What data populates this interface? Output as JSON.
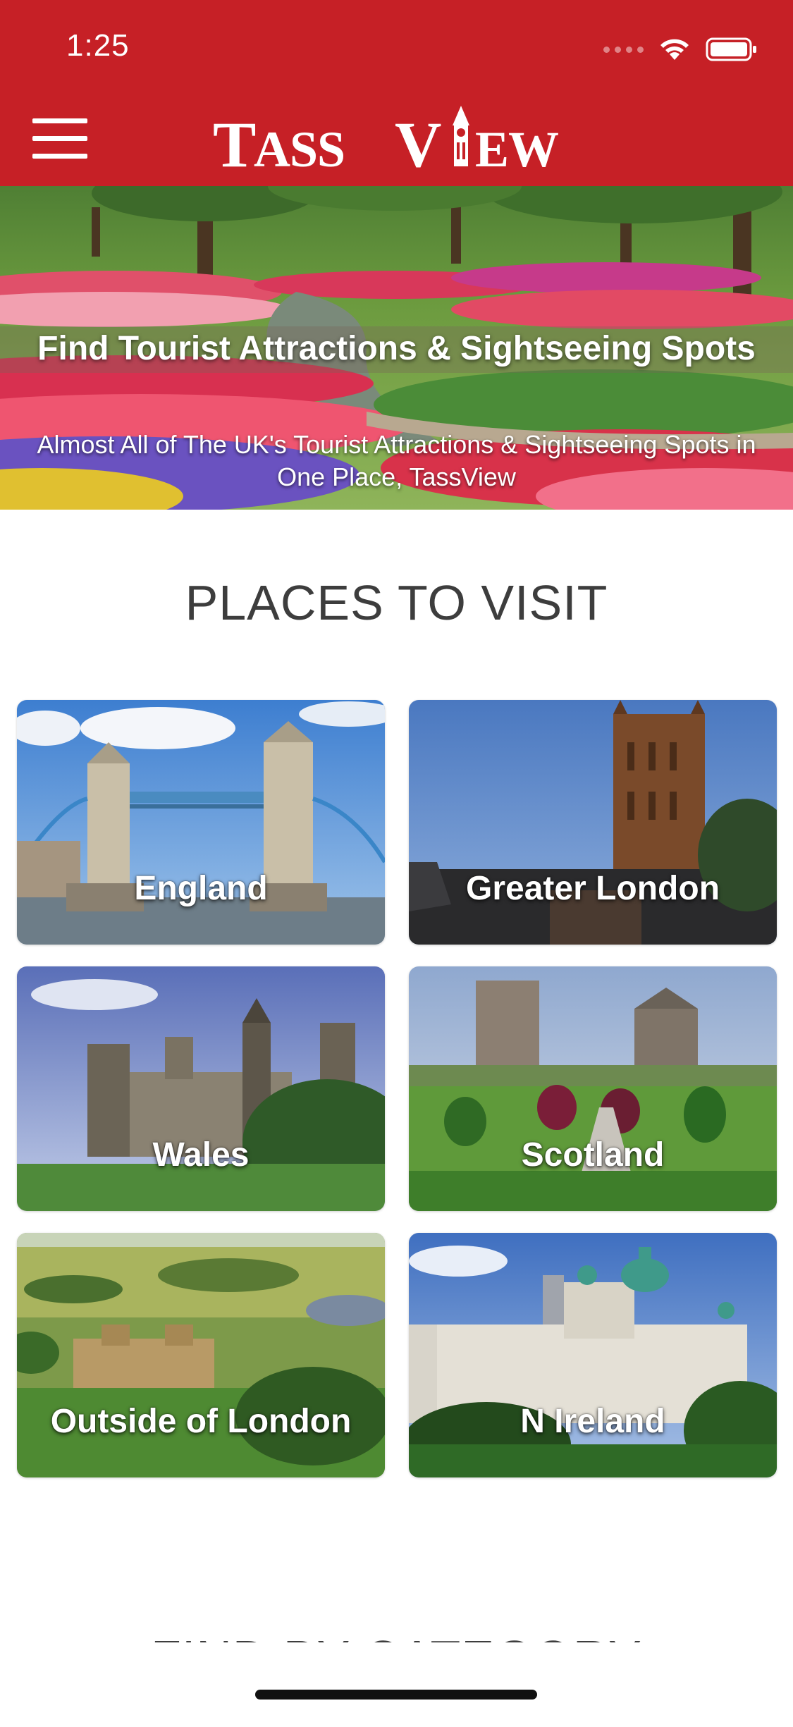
{
  "status_bar": {
    "time": "1:25"
  },
  "header": {
    "logo_text": "TASSVIEW",
    "background": "#c62026"
  },
  "hero": {
    "title": "Find Tourist Attractions & Sightseeing Spots",
    "subtitle": "Almost All of The UK's Tourist Attractions & Sightseeing Spots in One Place, TassView"
  },
  "places": {
    "heading": "PLACES TO VISIT",
    "items": [
      {
        "label": "England"
      },
      {
        "label": "Greater London"
      },
      {
        "label": "Wales"
      },
      {
        "label": "Scotland"
      },
      {
        "label": "Outside of London"
      },
      {
        "label": "N Ireland"
      }
    ]
  },
  "categories": {
    "heading": "FIND BY CATEGORY"
  }
}
